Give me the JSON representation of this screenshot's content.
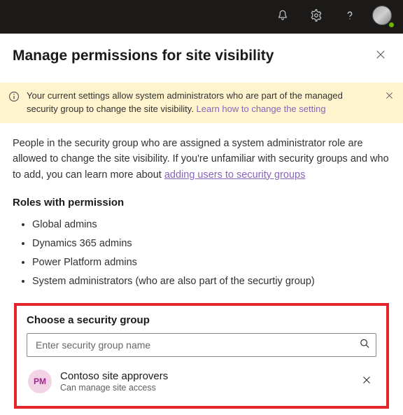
{
  "panel": {
    "title": "Manage permissions for site visibility"
  },
  "info_bar": {
    "text_prefix": "Your current settings allow system administrators who are part of the managed security group to change the site visibility. ",
    "link_text": "Learn how to change the setting"
  },
  "intro": {
    "text_prefix": "People in the security group who are assigned a system administrator role are allowed to change the site visibility. If you're unfamiliar with security groups and who to add, you can learn more about ",
    "link_text": "adding users to security groups"
  },
  "roles": {
    "heading": "Roles with permission",
    "items": [
      "Global admins",
      "Dynamics 365 admins",
      "Power Platform admins",
      "System administrators (who are also part of the securtiy group)"
    ]
  },
  "choose": {
    "heading": "Choose a security group",
    "placeholder": "Enter security group name"
  },
  "selected_group": {
    "initials": "PM",
    "name": "Contoso site approvers",
    "subtitle": "Can manage site access"
  }
}
